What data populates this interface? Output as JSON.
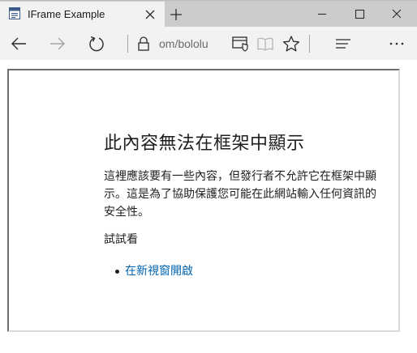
{
  "browser": {
    "tab_title": "IFrame Example",
    "address_text": "om/bololu",
    "icons": {
      "favicon": "page-favicon-icon",
      "tab_close": "close-icon",
      "new_tab": "plus-icon",
      "minimize": "minimize-icon",
      "maximize": "maximize-icon",
      "close": "close-icon",
      "back": "back-arrow-icon",
      "forward": "forward-arrow-icon",
      "refresh": "refresh-icon",
      "lock": "lock-icon",
      "tracking": "tracking-prevention-icon",
      "reading_view": "reading-view-icon",
      "favorite": "star-icon",
      "hub": "hub-icon",
      "more": "more-icon"
    }
  },
  "iframe_error": {
    "title": "此內容無法在框架中顯示",
    "body": "這裡應該要有一些內容，但發行者不允許它在框架中顯示。這是為了協助保護您可能在此網站輸入任何資訊的安全性。",
    "try_label": "試試看",
    "link_label": "在新視窗開啟"
  },
  "colors": {
    "titlebar_bg": "#cccccc",
    "active_tab_bg": "#f2f2f2",
    "toolbar_bg": "#f2f2f2",
    "link": "#0063b1"
  }
}
